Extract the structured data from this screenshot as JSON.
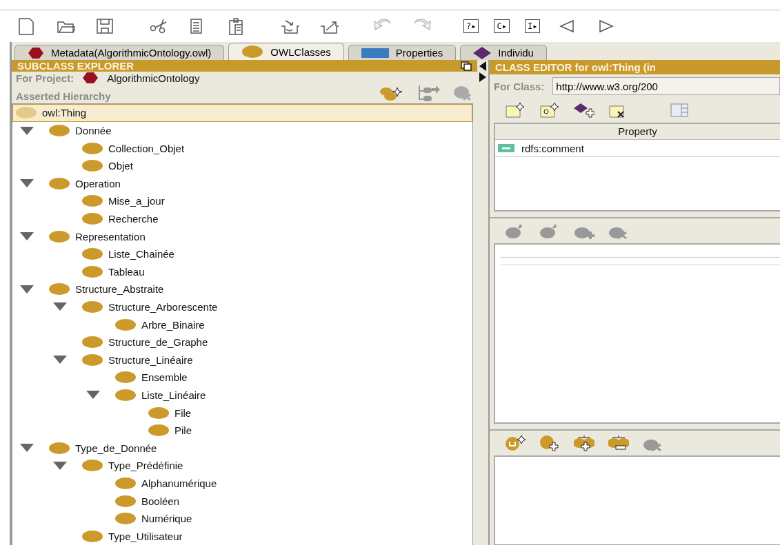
{
  "toolbar": [
    {
      "kind": "new"
    },
    {
      "kind": "open"
    },
    {
      "kind": "save"
    },
    {
      "kind": "cut"
    },
    {
      "kind": "copy"
    },
    {
      "kind": "paste"
    },
    {
      "kind": "import"
    },
    {
      "kind": "export"
    },
    {
      "kind": "undo"
    },
    {
      "kind": "redo"
    },
    {
      "kind": "text",
      "label": "?▸"
    },
    {
      "kind": "text",
      "label": "C▸"
    },
    {
      "kind": "text",
      "label": "I▸"
    },
    {
      "kind": "back"
    },
    {
      "kind": "forward"
    }
  ],
  "tabs": [
    {
      "label": "Metadata(AlgorithmicOntology.owl)",
      "kind": "ontology",
      "selected": false
    },
    {
      "label": "OWLClasses",
      "kind": "class",
      "selected": true
    },
    {
      "label": "Properties",
      "kind": "property",
      "selected": false
    },
    {
      "label": "Individu",
      "kind": "individual",
      "selected": false
    }
  ],
  "subclass_explorer": {
    "title": "SUBCLASS EXPLORER",
    "project_label": "For Project:",
    "project": "AlgorithmicOntology",
    "hierarchy_label": "Asserted Hierarchy",
    "tree": [
      {
        "label": "owl:Thing",
        "selected": true,
        "children": [
          {
            "label": "Donnée",
            "selected": false,
            "expanded": true,
            "children": [
              {
                "label": "Collection_Objet",
                "selected": false
              },
              {
                "label": "Objet",
                "selected": false
              }
            ]
          },
          {
            "label": "Operation",
            "selected": false,
            "expanded": true,
            "children": [
              {
                "label": "Mise_a_jour",
                "selected": false
              },
              {
                "label": "Recherche",
                "selected": false
              }
            ]
          },
          {
            "label": "Representation",
            "selected": false,
            "expanded": true,
            "children": [
              {
                "label": "Liste_Chainée",
                "selected": false
              },
              {
                "label": "Tableau",
                "selected": false
              }
            ]
          },
          {
            "label": "Structure_Abstraite",
            "selected": false,
            "expanded": true,
            "children": [
              {
                "label": "Structure_Arborescente",
                "selected": false,
                "expanded": true,
                "children": [
                  {
                    "label": "Arbre_Binaire",
                    "selected": false
                  }
                ]
              },
              {
                "label": "Structure_de_Graphe",
                "selected": false
              },
              {
                "label": "Structure_Linéaire",
                "selected": false,
                "expanded": true,
                "children": [
                  {
                    "label": "Ensemble",
                    "selected": false
                  },
                  {
                    "label": "Liste_Linéaire",
                    "selected": false,
                    "expanded": true,
                    "children": [
                      {
                        "label": "File",
                        "selected": false
                      },
                      {
                        "label": "Pile",
                        "selected": false
                      }
                    ]
                  }
                ]
              }
            ]
          },
          {
            "label": "Type_de_Donnée",
            "selected": false,
            "expanded": true,
            "children": [
              {
                "label": "Type_Prédéfinie",
                "selected": false,
                "expanded": true,
                "children": [
                  {
                    "label": "Alphanumérique",
                    "selected": false
                  },
                  {
                    "label": "Booléen",
                    "selected": false
                  },
                  {
                    "label": "Numérique",
                    "selected": false
                  }
                ]
              },
              {
                "label": "Type_Utilisateur",
                "selected": false
              }
            ]
          }
        ]
      }
    ]
  },
  "class_editor": {
    "title": "CLASS EDITOR for owl:Thing   (in",
    "class_label": "For Class:",
    "class_value": "http://www.w3.org/200",
    "table": {
      "columns": [
        "Property"
      ],
      "rows": [
        {
          "property": "rdfs:comment"
        }
      ]
    }
  }
}
